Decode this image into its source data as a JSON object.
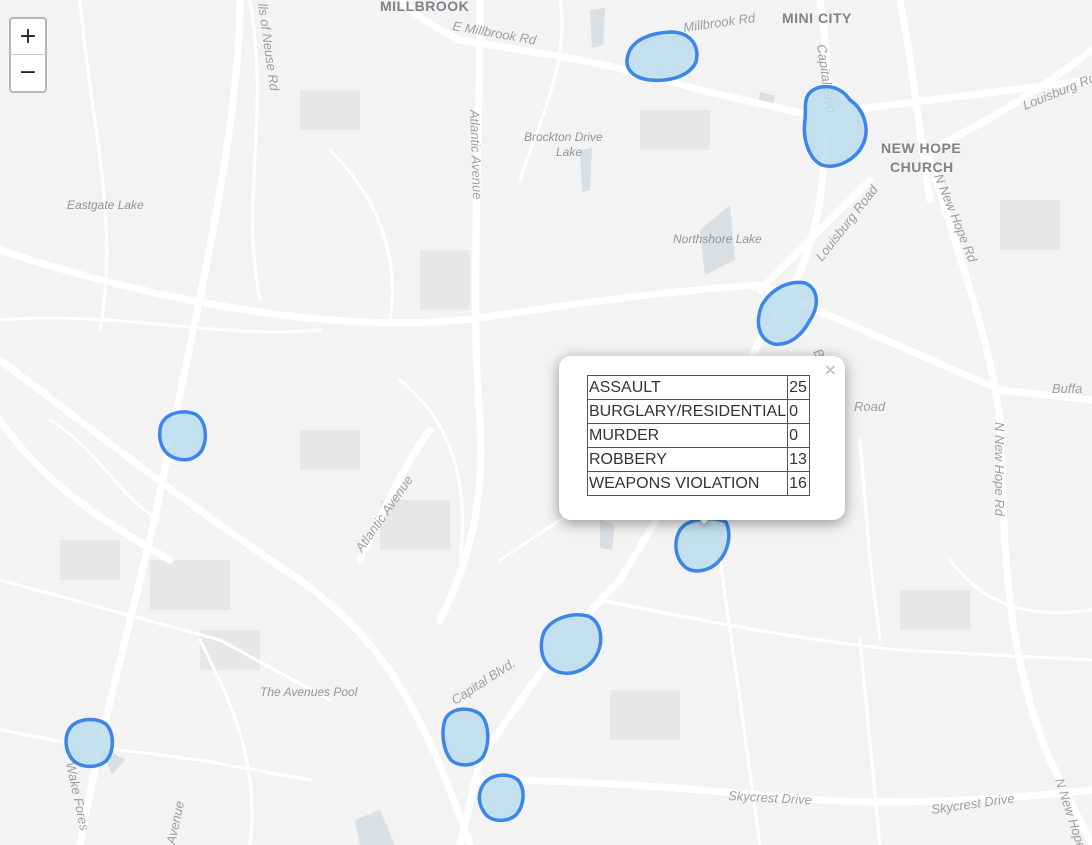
{
  "map": {
    "place_labels": {
      "millbrook": "MILLBROOK",
      "mini_city": "MINI CITY",
      "new_hope": "NEW HOPE",
      "church": "CHURCH"
    },
    "road_labels": {
      "e_millbrook_rd": "E Millbrook Rd",
      "millbrook_rd": "Millbrook Rd",
      "falls_of_neuse_rd": "lls of Neuse Rd",
      "atlantic_avenue_n": "Atlantic Avenue",
      "atlantic_avenue_s": "Atlantic Avenue",
      "capital_blvd_n": "Capital Blvd",
      "capital_blvd_s": "Capital Blvd.",
      "louisburg_road": "Louisburg Road",
      "louisburg_rd_ne": "Louisburg Rd",
      "n_new_hope_rd_n": "N New Hope Rd",
      "n_new_hope_rd_s": "N New Hope Rd",
      "n_new_hope_rd_se": "N New Hope Rd",
      "buffa": "Buffa",
      "skycrest_drive_w": "Skycrest Drive",
      "skycrest_drive_e": "Skycrest Drive",
      "wake_forest": "Wake Fores",
      "avenue": "Avenue",
      "road_fragment": "Road",
      "b_fragment": "B"
    },
    "water_labels": {
      "brockton": "Brockton Drive",
      "brockton_lake": "Lake",
      "eastgate": "Eastgate Lake",
      "northshore": "Northshore Lake",
      "avenues_pool": "The Avenues Pool"
    },
    "colors": {
      "background": "#f2f3f2",
      "road": "#ffffff",
      "polygon_stroke": "#3b86e8",
      "polygon_fill": "#bcdcef"
    }
  },
  "zoom": {
    "in_label": "+",
    "out_label": "−"
  },
  "popup": {
    "close_label": "×",
    "rows": [
      {
        "crime": "ASSAULT",
        "count": "25"
      },
      {
        "crime": "BURGLARY/RESIDENTIAL",
        "count": "0"
      },
      {
        "crime": "MURDER",
        "count": "0"
      },
      {
        "crime": "ROBBERY",
        "count": "13"
      },
      {
        "crime": "WEAPONS VIOLATION",
        "count": "16"
      }
    ]
  }
}
